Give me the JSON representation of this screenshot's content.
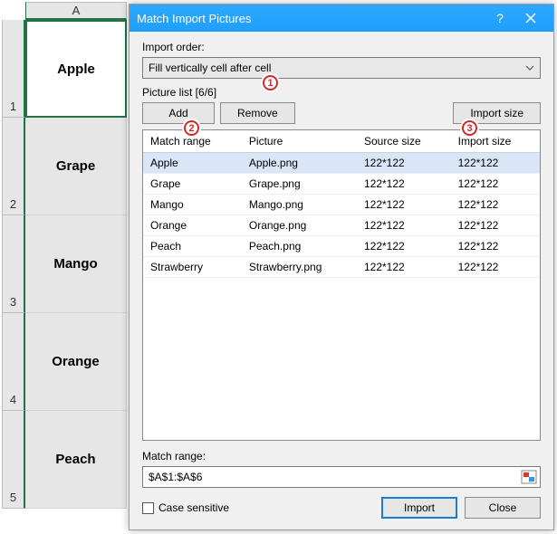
{
  "spreadsheet": {
    "col_label": "A",
    "rows": [
      "1",
      "2",
      "3",
      "4",
      "5"
    ],
    "cells": [
      "Apple",
      "Grape",
      "Mango",
      "Orange",
      "Peach"
    ]
  },
  "dialog": {
    "title": "Match Import Pictures",
    "import_order_label": "Import order:",
    "import_order_value": "Fill vertically cell after cell",
    "picture_list_label": "Picture list [6/6]",
    "add_label": "Add",
    "remove_label": "Remove",
    "import_size_label": "Import size",
    "columns": {
      "match_range": "Match range",
      "picture": "Picture",
      "source_size": "Source size",
      "import_size": "Import size"
    },
    "rows": [
      {
        "match": "Apple",
        "picture": "Apple.png",
        "src": "122*122",
        "imp": "122*122"
      },
      {
        "match": "Grape",
        "picture": "Grape.png",
        "src": "122*122",
        "imp": "122*122"
      },
      {
        "match": "Mango",
        "picture": "Mango.png",
        "src": "122*122",
        "imp": "122*122"
      },
      {
        "match": "Orange",
        "picture": "Orange.png",
        "src": "122*122",
        "imp": "122*122"
      },
      {
        "match": "Peach",
        "picture": "Peach.png",
        "src": "122*122",
        "imp": "122*122"
      },
      {
        "match": "Strawberry",
        "picture": "Strawberry.png",
        "src": "122*122",
        "imp": "122*122"
      }
    ],
    "match_range_label": "Match range:",
    "match_range_value": "$A$1:$A$6",
    "case_sensitive_label": "Case sensitive",
    "import_btn": "Import",
    "close_btn": "Close"
  },
  "callouts": {
    "one": "1",
    "two": "2",
    "three": "3"
  }
}
